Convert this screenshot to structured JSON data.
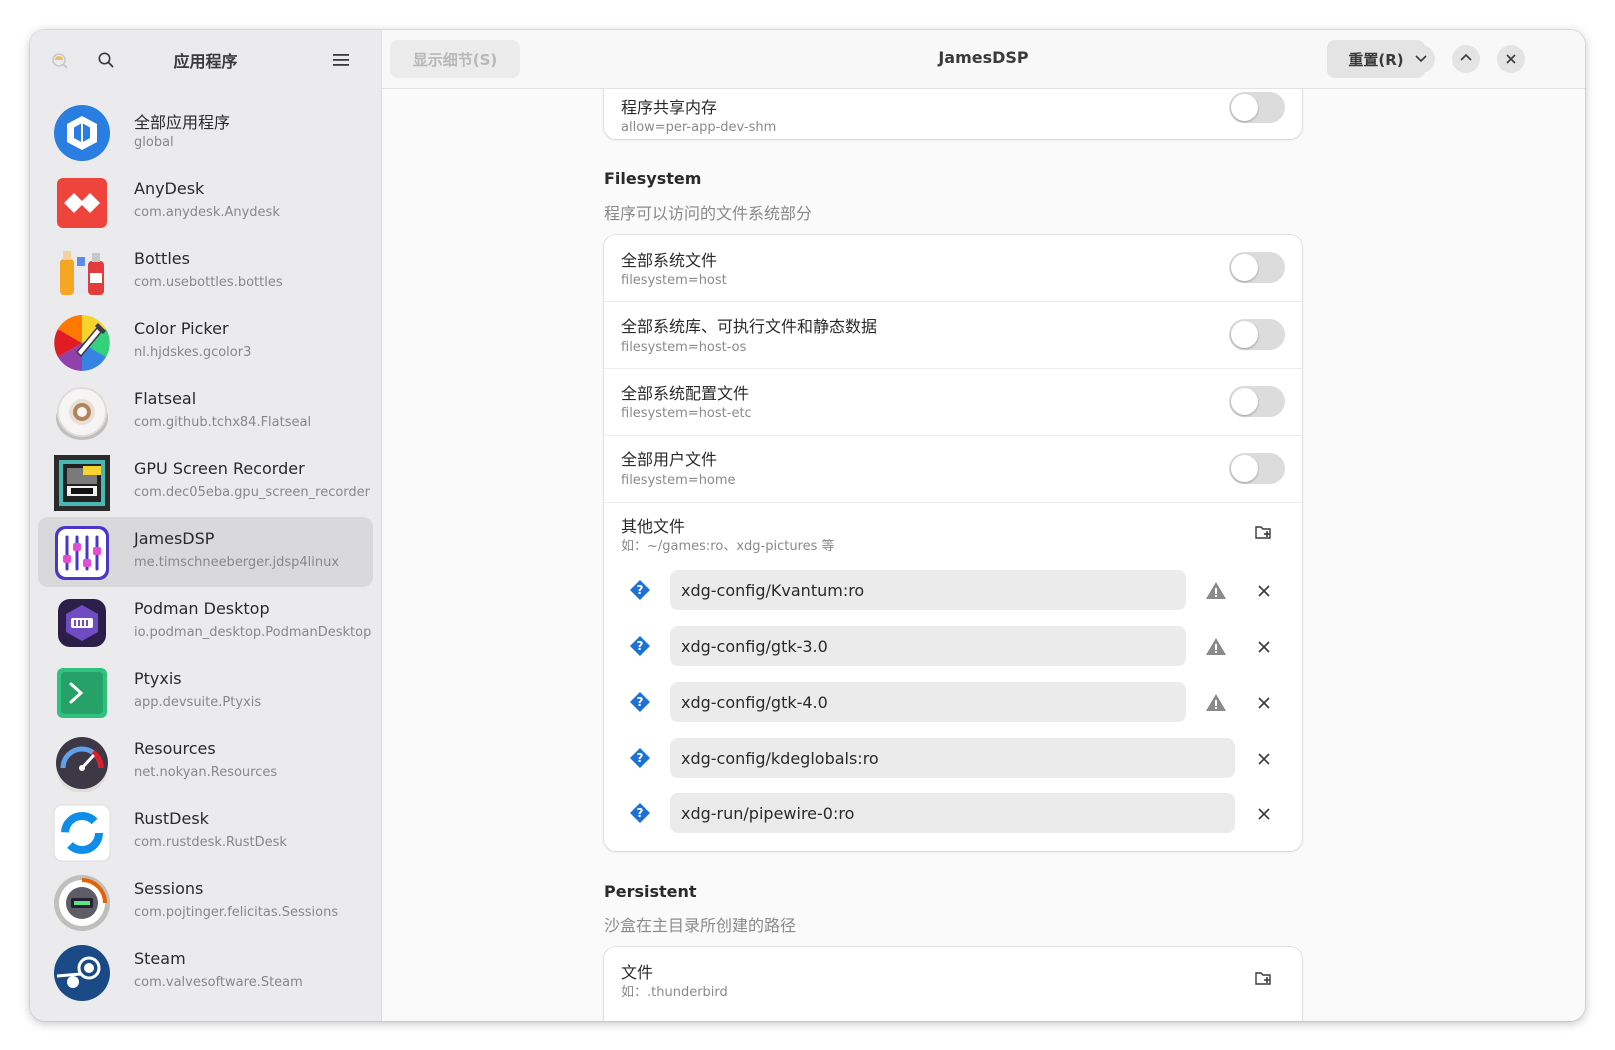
{
  "sidebar": {
    "title": "应用程序",
    "apps": [
      {
        "name": "全部应用程序",
        "id": "global",
        "icon": "flatpak-box-icon"
      },
      {
        "name": "AnyDesk",
        "id": "com.anydesk.Anydesk",
        "icon": "anydesk-icon"
      },
      {
        "name": "Bottles",
        "id": "com.usebottles.bottles",
        "icon": "bottles-icon"
      },
      {
        "name": "Color Picker",
        "id": "nl.hjdskes.gcolor3",
        "icon": "color-picker-icon"
      },
      {
        "name": "Flatseal",
        "id": "com.github.tchx84.Flatseal",
        "icon": "flatseal-icon"
      },
      {
        "name": "GPU Screen Recorder",
        "id": "com.dec05eba.gpu_screen_recorder",
        "icon": "gpu-recorder-icon"
      },
      {
        "name": "JamesDSP",
        "id": "me.timschneeberger.jdsp4linux",
        "icon": "jamesdsp-icon",
        "selected": true
      },
      {
        "name": "Podman Desktop",
        "id": "io.podman_desktop.PodmanDesktop",
        "icon": "podman-icon"
      },
      {
        "name": "Ptyxis",
        "id": "app.devsuite.Ptyxis",
        "icon": "ptyxis-icon"
      },
      {
        "name": "Resources",
        "id": "net.nokyan.Resources",
        "icon": "resources-icon"
      },
      {
        "name": "RustDesk",
        "id": "com.rustdesk.RustDesk",
        "icon": "rustdesk-icon"
      },
      {
        "name": "Sessions",
        "id": "com.pojtinger.felicitas.Sessions",
        "icon": "sessions-icon"
      },
      {
        "name": "Steam",
        "id": "com.valvesoftware.Steam",
        "icon": "steam-icon"
      }
    ]
  },
  "header": {
    "details_button": "显示细节(S)",
    "title": "JamesDSP",
    "reset_button": "重置(R)"
  },
  "top_card": {
    "title": "程序共享内存",
    "subtitle": "allow=per-app-dev-shm",
    "enabled": false
  },
  "filesystem": {
    "title": "Filesystem",
    "description": "程序可以访问的文件系统部分",
    "toggles": [
      {
        "title": "全部系统文件",
        "subtitle": "filesystem=host",
        "enabled": false
      },
      {
        "title": "全部系统库、可执行文件和静态数据",
        "subtitle": "filesystem=host-os",
        "enabled": false
      },
      {
        "title": "全部系统配置文件",
        "subtitle": "filesystem=host-etc",
        "enabled": false
      },
      {
        "title": "全部用户文件",
        "subtitle": "filesystem=home",
        "enabled": false
      }
    ],
    "other": {
      "title": "其他文件",
      "hint": "如：~/games:ro、xdg-pictures 等"
    },
    "paths": [
      {
        "value": "xdg-config/Kvantum:ro",
        "warning": true
      },
      {
        "value": "xdg-config/gtk-3.0",
        "warning": true
      },
      {
        "value": "xdg-config/gtk-4.0",
        "warning": true
      },
      {
        "value": "xdg-config/kdeglobals:ro",
        "warning": false
      },
      {
        "value": "xdg-run/pipewire-0:ro",
        "warning": false
      }
    ]
  },
  "persistent": {
    "title": "Persistent",
    "description": "沙盒在主目录所创建的路径",
    "files": {
      "title": "文件",
      "hint": "如：.thunderbird"
    }
  },
  "colors": {
    "accent": "#1c71d8",
    "selected_row": "#d9d9dc",
    "warning_icon": "#8a8a8a"
  }
}
